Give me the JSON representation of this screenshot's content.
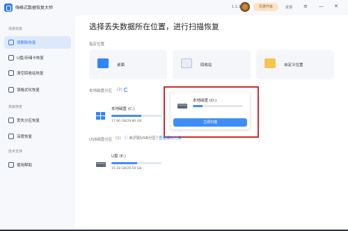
{
  "app": {
    "title": "嗨格式数据恢复大师",
    "version": "1.1.1",
    "upgrade_label": "优惠升级",
    "feedback_label": "反馈",
    "min_symbol": "—",
    "close_symbol": "✕",
    "menu_symbol": "≡"
  },
  "sidebar": {
    "sections": [
      {
        "title": "场景恢复",
        "items": [
          {
            "label": "误删除恢复",
            "icon": "trash-icon",
            "active": true
          },
          {
            "label": "U盘/存储卡恢复",
            "icon": "usb-icon",
            "active": false
          },
          {
            "label": "清空回收站恢复",
            "icon": "recycle-icon",
            "active": false
          },
          {
            "label": "误格式化恢复",
            "icon": "format-icon",
            "active": false
          }
        ]
      },
      {
        "title": "高级恢复",
        "items": [
          {
            "label": "丢失分区恢复",
            "icon": "partition-icon",
            "active": false
          },
          {
            "label": "深度恢复",
            "icon": "deep-scan-icon",
            "active": false
          }
        ]
      },
      {
        "title": "技术支持",
        "items": [
          {
            "label": "使用帮助",
            "icon": "help-icon",
            "active": false
          }
        ]
      }
    ]
  },
  "main": {
    "title": "选择丢失数据所在位置，进行扫描恢复",
    "location_section_label": "指定位置",
    "locations": [
      {
        "label": "桌面",
        "icon": "desktop-icon"
      },
      {
        "label": "回收站",
        "icon": "recycle-bin-icon"
      },
      {
        "label": "自定义位置",
        "icon": "folder-icon"
      }
    ],
    "local_section_label": "本地磁盘分区",
    "local_count": "(2)",
    "drives": [
      {
        "name": "本地磁盘 (C:)",
        "size": "17.96 GB/29.80 GB",
        "used_fraction": 0.6
      },
      {
        "name": "本地磁盘 (D:)",
        "size": "",
        "used_fraction": 0.2,
        "scan_label": "立即扫描"
      }
    ],
    "usb_section_label": "USB磁盘分区",
    "usb_count": "(1)",
    "usb_warning": "未识别USB分区？",
    "usb_solution": "查看解决方案",
    "usb_drives": [
      {
        "name": "U盘 (E:)",
        "size": "15.18 GB/29.59 GB",
        "used_fraction": 0.51
      }
    ]
  },
  "colors": {
    "accent": "#3f8ef7",
    "highlight": "#d22a2a",
    "active_bg": "#dde9fb"
  }
}
